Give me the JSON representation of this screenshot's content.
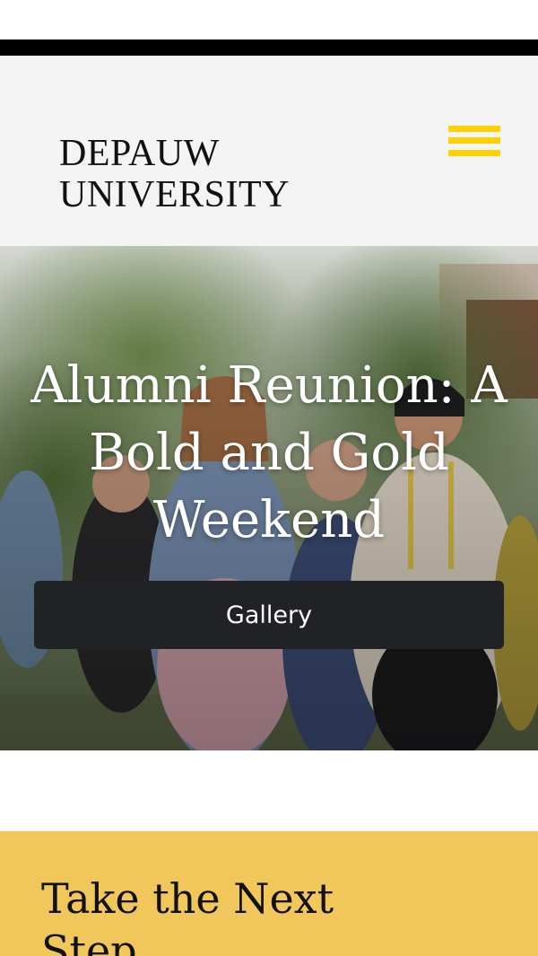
{
  "header": {
    "logo_line1": "DEPAUW",
    "logo_line2": "UNIVERSITY",
    "menu_icon": "hamburger-menu-icon"
  },
  "hero": {
    "title": "Alumni Reunion: A Bold and Gold Weekend",
    "button_label": "Gallery"
  },
  "cta": {
    "heading": "Take the Next Step"
  },
  "colors": {
    "black_bar": "#000000",
    "header_bg": "#f4f4f4",
    "accent_gold": "#ffd100",
    "button_bg": "#202225",
    "cta_bg": "#f1c65a"
  }
}
